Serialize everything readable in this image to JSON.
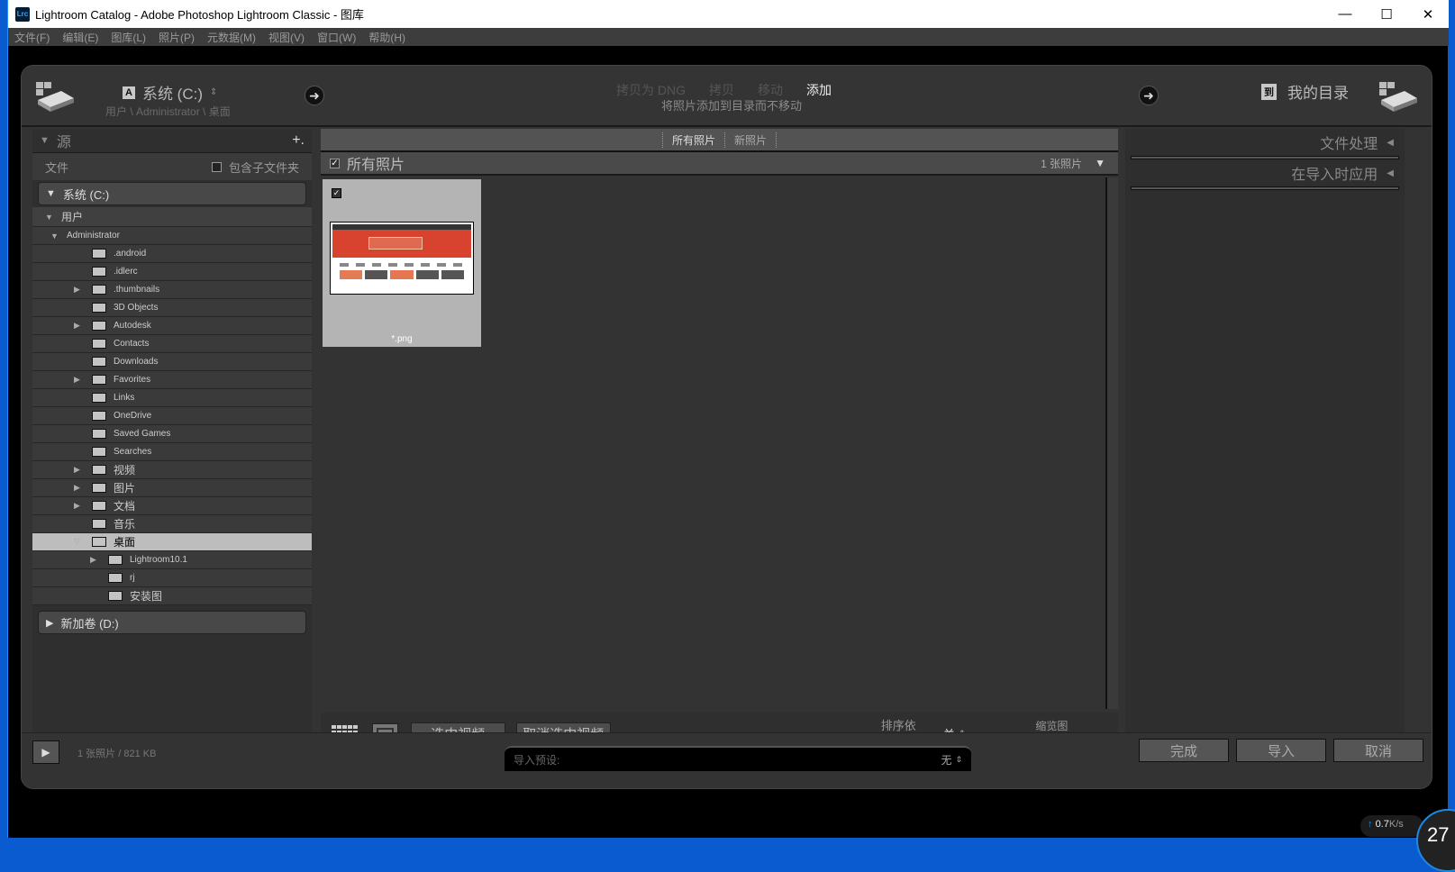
{
  "window": {
    "title": "Lightroom Catalog - Adobe Photoshop Lightroom Classic - 图库",
    "logo": "Lrc",
    "controls": [
      "minimize-icon",
      "maximize-icon",
      "close-icon"
    ]
  },
  "menu": [
    "文件(F)",
    "编辑(E)",
    "图库(L)",
    "照片(P)",
    "元数据(M)",
    "视图(V)",
    "窗口(W)",
    "帮助(H)"
  ],
  "header": {
    "source_badge": "A",
    "source_name": "系统 (C:)",
    "source_path": "用户 \\ Administrator \\ 桌面",
    "modes": [
      "拷贝为 DNG",
      "拷贝",
      "移动",
      "添加"
    ],
    "active_mode": "添加",
    "mode_desc": "将照片添加到目录而不移动",
    "dest_badge": "到",
    "dest_name": "我的目录"
  },
  "left": {
    "title": "源",
    "add": "+.",
    "files_label": "文件",
    "include_sub": "包含子文件夹",
    "include_sub_checked": false,
    "volume_c": "系统 (C:)",
    "volume_d": "新加卷 (D:)",
    "tree": [
      {
        "label": "用户",
        "level": 0,
        "tri": "▼",
        "cn": true,
        "folder": false
      },
      {
        "label": "Administrator",
        "level": 1,
        "tri": "▼",
        "folder": false
      },
      {
        "label": ".android",
        "level": 2,
        "tri": ""
      },
      {
        "label": ".idlerc",
        "level": 2,
        "tri": ""
      },
      {
        "label": ".thumbnails",
        "level": 2,
        "tri": "▶"
      },
      {
        "label": "3D Objects",
        "level": 2,
        "tri": ""
      },
      {
        "label": "Autodesk",
        "level": 2,
        "tri": "▶"
      },
      {
        "label": "Contacts",
        "level": 2,
        "tri": ""
      },
      {
        "label": "Downloads",
        "level": 2,
        "tri": ""
      },
      {
        "label": "Favorites",
        "level": 2,
        "tri": "▶"
      },
      {
        "label": "Links",
        "level": 2,
        "tri": ""
      },
      {
        "label": "OneDrive",
        "level": 2,
        "tri": ""
      },
      {
        "label": "Saved Games",
        "level": 2,
        "tri": ""
      },
      {
        "label": "Searches",
        "level": 2,
        "tri": ""
      },
      {
        "label": "视频",
        "level": 2,
        "tri": "▶",
        "cn": true
      },
      {
        "label": "图片",
        "level": 2,
        "tri": "▶",
        "cn": true
      },
      {
        "label": "文档",
        "level": 2,
        "tri": "▶",
        "cn": true
      },
      {
        "label": "音乐",
        "level": 2,
        "tri": "",
        "cn": true
      },
      {
        "label": "桌面",
        "level": 2,
        "tri": "▽",
        "cn": true,
        "selected": true
      },
      {
        "label": "Lightroom10.1",
        "level": 3,
        "tri": "▶"
      },
      {
        "label": "rj",
        "level": 3,
        "tri": ""
      },
      {
        "label": "安装图",
        "level": 3,
        "tri": "",
        "cn": true
      }
    ]
  },
  "center": {
    "filters": [
      "所有照片",
      "新照片"
    ],
    "active_filter": "所有照片",
    "all_label": "所有照片",
    "count": "1 张照片",
    "photo": {
      "filename": "*.png",
      "checked": true
    },
    "check_video": "选中视频",
    "uncheck_video": "取消选中视频",
    "sort_label": "排序依据:",
    "sort_value": "关",
    "thumb_label": "缩览图",
    "thumb_size": 0.2
  },
  "right": {
    "sections": [
      "文件处理",
      "在导入时应用"
    ]
  },
  "footer": {
    "info": "1 张照片 / 821 KB",
    "preset_label": "导入预设:",
    "preset_value": "无",
    "done": "完成",
    "import": "导入",
    "cancel": "取消"
  },
  "overlay": {
    "upload": "0.7",
    "unit": "K/s",
    "percent": "27"
  }
}
